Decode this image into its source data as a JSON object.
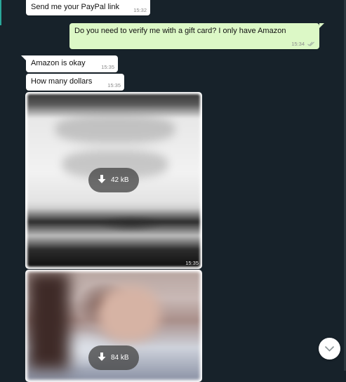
{
  "messages": {
    "m1": {
      "text": "Send me your PayPal link",
      "time": "15:32"
    },
    "m2": {
      "text": "Do you need to verify me with a gift card? I only have Amazon",
      "time": "15:34"
    },
    "m3": {
      "text": "Amazon is okay",
      "time": "15:35"
    },
    "m4": {
      "text": "How many dollars",
      "time": "15:35"
    },
    "img1": {
      "size": "42 kB",
      "time": "15:35"
    },
    "img2": {
      "size": "84 kB"
    }
  },
  "icons": {
    "download": "download-icon",
    "read_receipt": "double-check-icon",
    "scroll_down": "chevron-down-icon"
  },
  "colors": {
    "chat_background": "#17222a",
    "incoming_bubble": "#ffffff",
    "outgoing_bubble": "#dcf8c6",
    "accent": "#2aa79a"
  }
}
